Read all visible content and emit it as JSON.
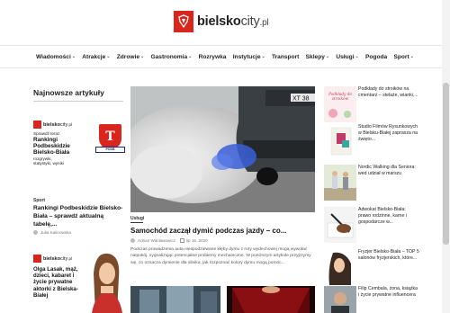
{
  "header": {
    "logo_bold": "bielsko",
    "logo_thin": "city",
    "logo_tld": ".pl"
  },
  "nav": {
    "items": [
      {
        "label": "Wiadomości",
        "has_dropdown": true
      },
      {
        "label": "Atrakcje",
        "has_dropdown": true
      },
      {
        "label": "Zdrowie",
        "has_dropdown": true
      },
      {
        "label": "Gastronomia",
        "has_dropdown": true
      },
      {
        "label": "Rozrywka",
        "has_dropdown": false
      },
      {
        "label": "Instytucje",
        "has_dropdown": true
      },
      {
        "label": "Transport",
        "has_dropdown": false
      },
      {
        "label": "Sklepy",
        "has_dropdown": true
      },
      {
        "label": "Usługi",
        "has_dropdown": true
      },
      {
        "label": "Pogoda",
        "has_dropdown": false
      },
      {
        "label": "Sport",
        "has_dropdown": true
      }
    ]
  },
  "left": {
    "section_title": "Najnowsze artykuły",
    "promo1": {
      "brand": "bielsko",
      "brand_thin": "city",
      "brand_tld": ".pl",
      "line1": "Sprawdź teraz",
      "big1": "Rankingi",
      "big2": "Podbeskidzie",
      "big3": "Bielsko-Biała",
      "line2": "rozgrywki,",
      "line3": "statystyki, wyniki",
      "badge_letter": "T",
      "badge_ribbon": "PODB"
    },
    "article": {
      "category": "Sport",
      "title": "Rankingi Podbeskidzie Bielsko-Biała – sprawdź aktualną tabelę,...",
      "author": "Julia Kalinowska"
    },
    "promo2": {
      "brand": "bielsko",
      "brand_thin": "city",
      "brand_tld": ".pl",
      "text": "Olga Lasak, mąż, dzieci, kabaret i życie prywatne aktorki z Bielska-Białej"
    }
  },
  "center": {
    "category": "Usługi",
    "title": "Samochód zaczął dymić podczas jazdy – co...",
    "author": "Adrian Wacławowicz",
    "date": "lip 16, 2020",
    "excerpt": "Podczas prowadzenia auta niespodziewane kłęby dymu z rury wydechowej mogą wywołać niepokój, sygnalizując potencjalne problemy mechaniczne. W poniższym artykule przyjrzymy się, co oznacza dymienie dla silnika, jak rozpoznać kolory dymu mogą pomóc..."
  },
  "right": {
    "items": [
      {
        "text": "Podkłady do stroików na cmentarz – stelaże, wianki,...",
        "thumb_caption": "Podkłady do stroików"
      },
      {
        "text": "Studio Filmów Rysunkowych w Bielsku-Białej zaprasza na święto...",
        "thumb_caption": ""
      },
      {
        "text": "Nordic Walking dla Seniora: wed udział w marszu",
        "thumb_caption": ""
      },
      {
        "text": "Adwokat Bielsko-Biała: prawo rodzinne, karne i gospodarcze w...",
        "thumb_caption": ""
      },
      {
        "text": "Fryzjer Bielsko-Biała – TOP 5 salonów fryzjerskich, które...",
        "thumb_caption": ""
      },
      {
        "text": "Filip Cembala, żona, książka i życie prywatne influencera",
        "thumb_caption": ""
      }
    ]
  }
}
